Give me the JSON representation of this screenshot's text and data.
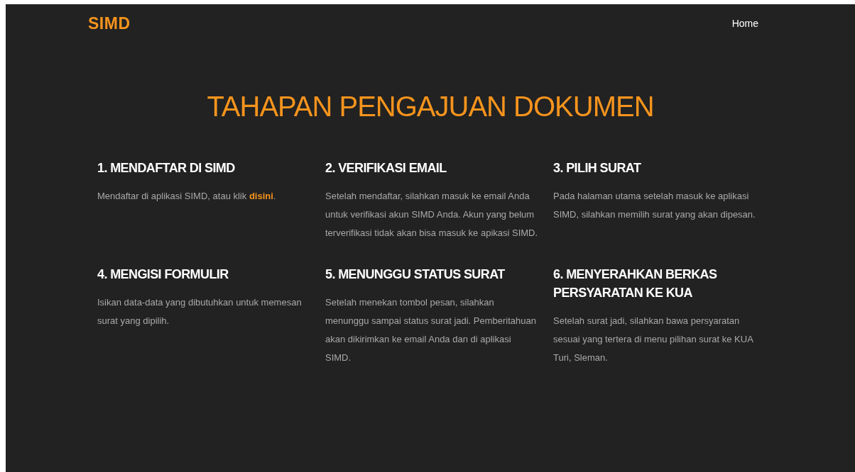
{
  "navbar": {
    "brand": "SIMD",
    "links": [
      {
        "label": "Home"
      }
    ]
  },
  "title": "TAHAPAN PENGAJUAN DOKUMEN",
  "steps": [
    {
      "title": "1. MENDAFTAR DI SIMD",
      "text": "Mendaftar di aplikasi SIMD, atau klik ",
      "link": "disini",
      "text_after": "."
    },
    {
      "title": "2. VERIFIKASI EMAIL",
      "text": "Setelah mendaftar, silahkan masuk ke email Anda untuk verifikasi akun SIMD Anda. Akun yang belum terverifikasi tidak akan bisa masuk ke apikasi SIMD."
    },
    {
      "title": "3. PILIH SURAT",
      "text": "Pada halaman utama setelah masuk ke aplikasi SIMD, silahkan memilih surat yang akan dipesan."
    },
    {
      "title": "4. MENGISI FORMULIR",
      "text": "Isikan data-data yang dibutuhkan untuk memesan surat yang dipilih."
    },
    {
      "title": "5. MENUNGGU STATUS SURAT",
      "text": "Setelah menekan tombol pesan, silahkan menunggu sampai status surat jadi. Pemberitahuan akan dikirimkan ke email Anda dan di aplikasi SIMD."
    },
    {
      "title": "6. MENYERAHKAN BERKAS PERSYARATAN KE KUA",
      "text": "Setelah surat jadi, silahkan bawa persyaratan sesuai yang tertera di menu pilihan surat ke KUA Turi, Sleman."
    }
  ]
}
